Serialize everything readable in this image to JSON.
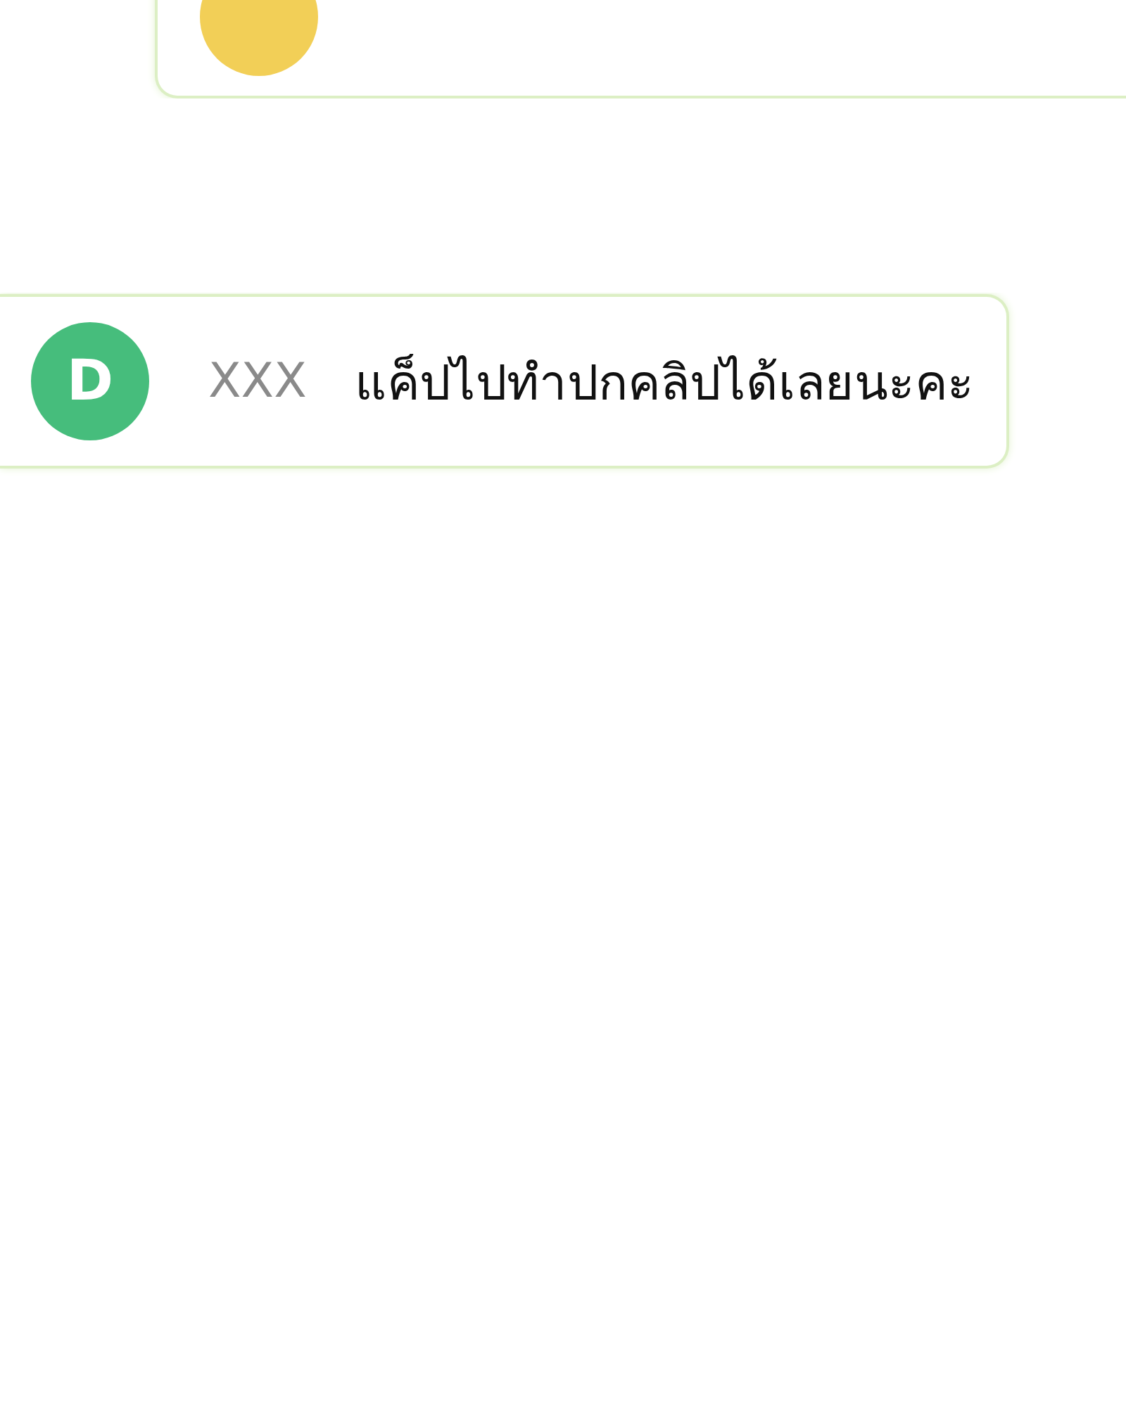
{
  "comments": [
    {
      "avatar": {
        "color": "#f2cf57"
      }
    },
    {
      "avatar": {
        "letter": "D",
        "color": "#46bd7c"
      },
      "name": "XXX",
      "message": "แค็ปไปทำปกคลิปได้เลยนะคะ"
    }
  ]
}
